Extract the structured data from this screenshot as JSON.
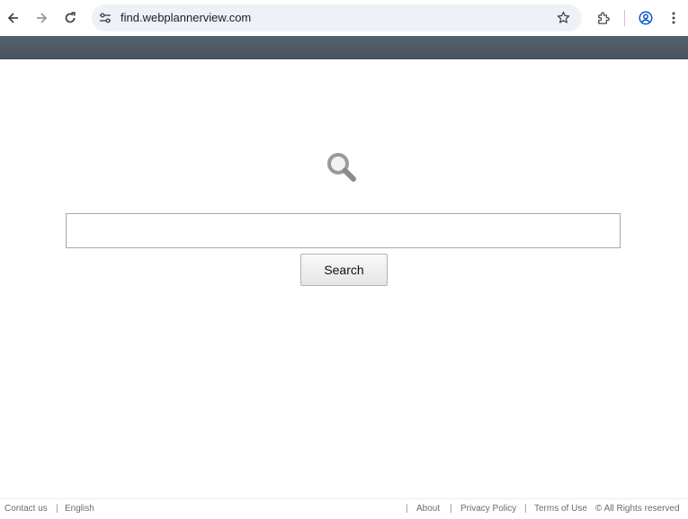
{
  "browser": {
    "url": "find.webplannerview.com",
    "back_icon": "arrow-left-icon",
    "forward_icon": "arrow-right-icon",
    "reload_icon": "reload-icon",
    "site_info_icon": "tune-icon",
    "bookmark_icon": "star-icon",
    "extensions_icon": "puzzle-icon",
    "profile_icon": "account-circle-icon",
    "menu_icon": "more-vert-icon"
  },
  "banner": {
    "color": "#4f5b65"
  },
  "search": {
    "icon": "magnifier-icon",
    "input_value": "",
    "input_placeholder": "",
    "button_label": "Search"
  },
  "footer": {
    "left": [
      "Contact us",
      "English"
    ],
    "right": [
      "About",
      "Privacy Policy",
      "Terms of Use"
    ],
    "copyright": "© All Rights reserved",
    "separator": "|"
  }
}
